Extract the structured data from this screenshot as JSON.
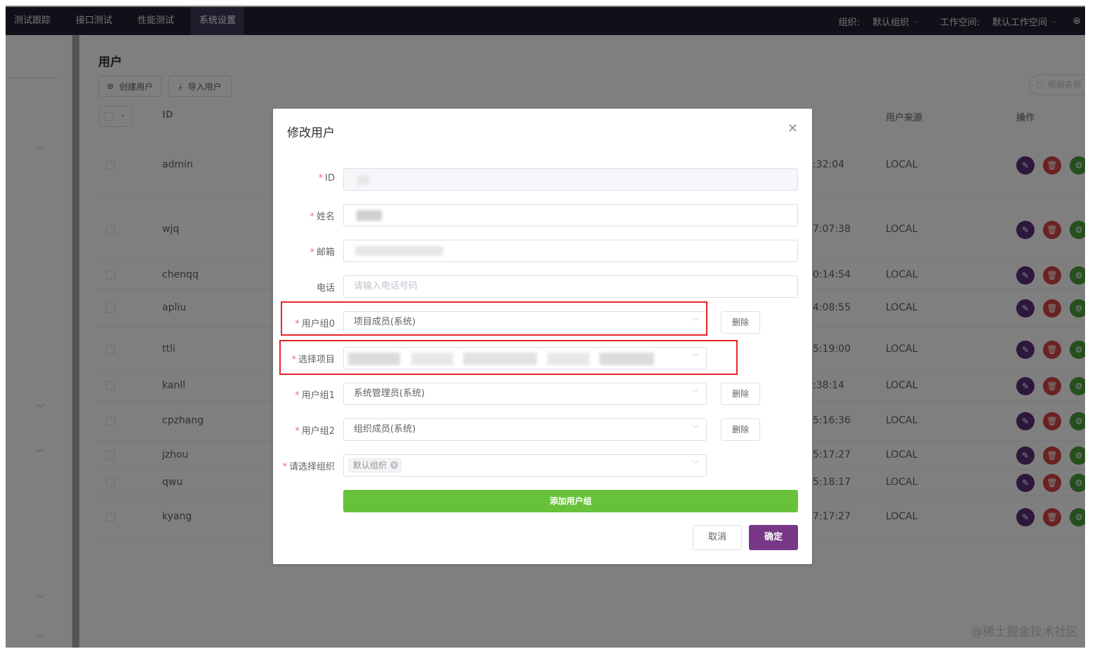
{
  "topnav": {
    "tabs": [
      "测试跟踪",
      "接口测试",
      "性能测试",
      "系统设置"
    ],
    "active_tab": "系统设置",
    "org_label": "组织:",
    "org_value": "默认组织",
    "workspace_label": "工作空间:",
    "workspace_value": "默认工作空间",
    "lang_icon": "globe-icon"
  },
  "page": {
    "title": "用户",
    "create_button": "创建用户",
    "import_button": "导入用户",
    "search_placeholder": "根据名称",
    "watermark": "@稀土掘金技术社区"
  },
  "table": {
    "headers": {
      "id": "ID",
      "source": "用户来源",
      "actions": "操作"
    },
    "rows": [
      {
        "id": "admin",
        "time": ":32:04",
        "source": "LOCAL"
      },
      {
        "id": "wjq",
        "time": "7:07:38",
        "source": "LOCAL"
      },
      {
        "id": "chenqq",
        "time": "0:14:54",
        "source": "LOCAL"
      },
      {
        "id": "apliu",
        "time": "4:08:55",
        "source": "LOCAL"
      },
      {
        "id": "ttli",
        "time": "5:19:00",
        "source": "LOCAL"
      },
      {
        "id": "kanll",
        "time": ":38:14",
        "source": "LOCAL"
      },
      {
        "id": "cpzhang",
        "time": "5:16:36",
        "source": "LOCAL"
      },
      {
        "id": "jzhou",
        "time": "5:17:27",
        "source": "LOCAL"
      },
      {
        "id": "qwu",
        "time": "5:18:17",
        "source": "LOCAL"
      },
      {
        "id": "kyang",
        "time": "7:17:27",
        "source": "LOCAL"
      }
    ]
  },
  "dialog": {
    "title": "修改用户",
    "close_icon": "close-icon",
    "fields": {
      "id_label": "ID",
      "name_label": "姓名",
      "email_label": "邮箱",
      "phone_label": "电话",
      "phone_placeholder": "请输入电话号码"
    },
    "groups": [
      {
        "label": "用户组0",
        "value": "项目成员(系统)",
        "delete": "删除"
      },
      {
        "label": "选择项目",
        "value": ""
      },
      {
        "label": "用户组1",
        "value": "系统管理员(系统)",
        "delete": "删除"
      },
      {
        "label": "用户组2",
        "value": "组织成员(系统)",
        "delete": "删除"
      }
    ],
    "org_label": "请选择组织",
    "org_tag": "默认组织",
    "add_group_button": "添加用户组",
    "cancel_button": "取消",
    "confirm_button": "确定"
  },
  "colors": {
    "accent": "#783887",
    "add_green": "#67c23a",
    "highlight_red": "#e8262a",
    "nav_bg": "#202033"
  }
}
